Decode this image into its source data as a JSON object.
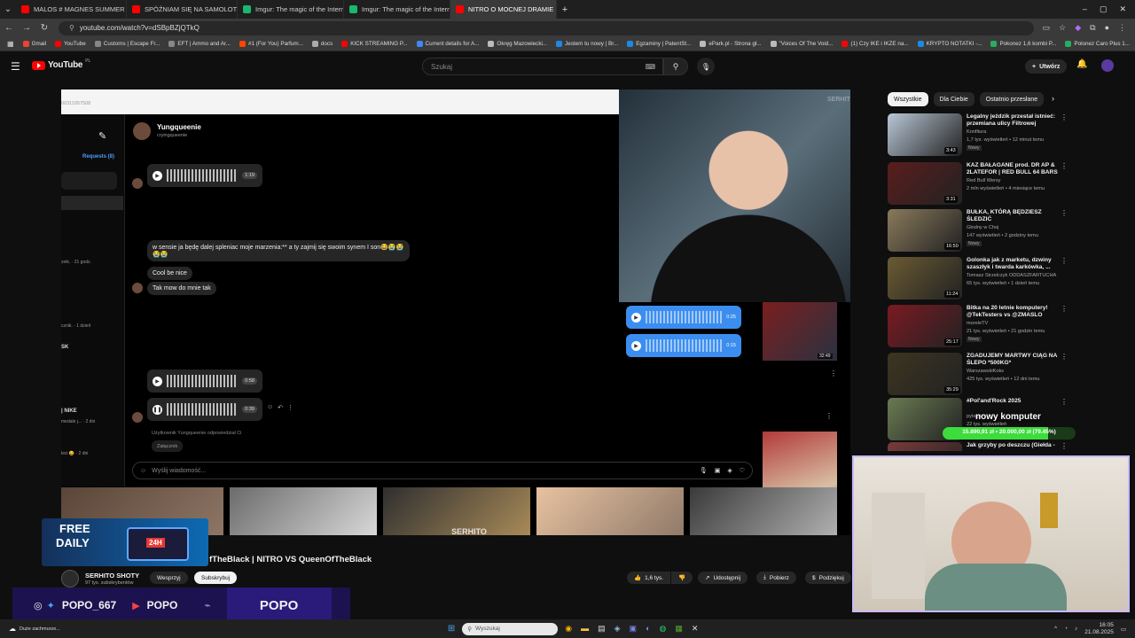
{
  "browser": {
    "tabs": [
      {
        "label": "MALOS # MAGNES SUMMER",
        "color": "#ff0000"
      },
      {
        "label": "SPÓŹNIAM SIĘ NA SAMOLOT",
        "color": "#ff0000"
      },
      {
        "label": "Imgur: The magic of the Intern",
        "color": "#1bb76e"
      },
      {
        "label": "Imgur: The magic of the Intern",
        "color": "#1bb76e"
      },
      {
        "label": "NITRO O MOCNEJ DRAMIE",
        "color": "#ff0000"
      }
    ],
    "url": "youtube.com/watch?v=dSBpBZjQTkQ",
    "bookmarks": [
      {
        "label": "Gmail",
        "color": "#ea4335"
      },
      {
        "label": "YouTube",
        "color": "#ff0000"
      },
      {
        "label": "Customs | Escape Fr...",
        "color": "#888888"
      },
      {
        "label": "EFT | Ammo and Ar...",
        "color": "#888888"
      },
      {
        "label": "#1 (For You) Parfum...",
        "color": "#ff4500"
      },
      {
        "label": "docs",
        "color": "#aaaaaa"
      },
      {
        "label": "KICK STREAMING P...",
        "color": "#ff0000"
      },
      {
        "label": "Current details for A...",
        "color": "#4285f4"
      },
      {
        "label": "Okręg Mazowiecki...",
        "color": "#bbbbbb"
      },
      {
        "label": "Jestem tu nowy | Br...",
        "color": "#1e88e5"
      },
      {
        "label": "Egzaminy | PatentSt...",
        "color": "#1e88e5"
      },
      {
        "label": "ePark.pl - Strona gł...",
        "color": "#bbbbbb"
      },
      {
        "label": "\"Voices Of The Void...",
        "color": "#bbbbbb"
      },
      {
        "label": "(1) Czy IKE i IKZE na...",
        "color": "#ff0000"
      },
      {
        "label": "KRYPTO NOTATKI -...",
        "color": "#1e88e5"
      },
      {
        "label": "Pokonez 1,6 kombi P...",
        "color": "#27ae60"
      },
      {
        "label": "Polonez Caro Plus 1...",
        "color": "#27ae60"
      }
    ]
  },
  "youtube": {
    "logo": "YouTube",
    "region": "PL",
    "search_placeholder": "Szukaj",
    "create_label": "Utwórz",
    "filters": [
      "Wszystkie",
      "Dla Ciebie",
      "Ostatnio przesłane"
    ],
    "video_title": "fTheBlack | NITRO VS QueenOfTheBlack",
    "channel_name": "SERHITO SHOTY",
    "channel_subs": "97 tys. subskrybentów",
    "support_label": "Wesprzyj",
    "subscribe_label": "Subskrybuj",
    "likes": "1,6 tys.",
    "share_label": "Udostępnij",
    "download_label": "Pobierz",
    "thanks_label": "Podziękuj",
    "watermark": "SERHITO SHOTY"
  },
  "dm": {
    "account_id": "00311957508",
    "username": "Yungqueenie",
    "handle": "cryingqueenie",
    "requests_label": "Requests (8)",
    "sidebar_texts": [
      "znik. · 21 godz.",
      "cznik. · 1 dzień",
      "SK",
      "| NIKE",
      "medale j... · 2 dni",
      "leci 😀 · 2 dni"
    ],
    "messages": [
      {
        "text": "w sensie ja będę dalej spleniac moje marzenia:** a ty zajmij się swoim synem I son😂😭😭😭😭"
      },
      {
        "text": "Cool be nice"
      },
      {
        "text": "Tak mow do mnie tak"
      }
    ],
    "voice_times": [
      "1:19",
      "0:58",
      "0:39"
    ],
    "sent_voice_times": [
      "0:25",
      "0:15"
    ],
    "reply_note": "Użytkownik Yungqueenie odpowiedział Ci",
    "reply_preview": "Załącznik",
    "input_placeholder": "Wyślij wiadomość...",
    "thumb_duration": "32:49"
  },
  "recommendations": [
    {
      "title": "Legalny jeździk przestał istnieć: przemiana ulicy Filtrowej",
      "channel": "Konfitura",
      "meta": "1,7 tys. wyświetleń • 12 minut temu",
      "badge": "Nowy",
      "duration": "3:43",
      "color": "#b9c7d6"
    },
    {
      "title": "KAZ BAŁAGANE prod. DR AP & 2LATEFOR | RED BULL 64 BARS",
      "channel": "Red Bull Wersy",
      "meta": "2 mln wyświetleń • 4 miesiące temu",
      "badge": "",
      "duration": "3:31",
      "color": "#5a1d1d"
    },
    {
      "title": "BUŁKA, KTÓRĄ BĘDZIESZ ŚLEDZIĆ",
      "channel": "Głodny w Choj",
      "meta": "147 wyświetleń • 2 godziny temu",
      "badge": "Nowy",
      "duration": "16:50",
      "color": "#8a7a5c"
    },
    {
      "title": "Golonka jak z marketu, dzwiny szaszłyk i twarda karkówka, ...",
      "channel": "Tomasz Strzelczyk ODDASZFARTUCHA",
      "meta": "65 tys. wyświetleń • 1 dzień temu",
      "badge": "",
      "duration": "11:24",
      "color": "#6b5b33"
    },
    {
      "title": "Bitka na 20 letnie komputery! @TekTesters vs @ZMASLO",
      "channel": "moreleTV",
      "meta": "21 tys. wyświetleń • 21 godzin temu",
      "badge": "Nowy",
      "duration": "25:17",
      "color": "#7a1a22"
    },
    {
      "title": "ZGADUJEMY MARTWY CIĄG NA ŚLEPO *500KG*",
      "channel": "WarszawskiKoks",
      "meta": "425 tys. wyświetleń • 12 dni temu",
      "badge": "",
      "duration": "35:29",
      "color": "#3d3521"
    },
    {
      "title": "#Pol'and'Rock 2025",
      "channel": "pyta.pl",
      "meta": "22 tys. wyświetleń",
      "badge": "",
      "duration": "",
      "color": "#6a7b53"
    },
    {
      "title": "Jak grzyby po deszczu (Giełda - ...",
      "channel": "",
      "meta": "",
      "badge": "",
      "duration": "",
      "color": "#7a3a3a"
    }
  ],
  "overlay": {
    "goal_title": "nowy komputer",
    "goal_progress": "15.890,91 zł • 20.000,00 zł (79.45%)",
    "goal_fraction": 0.7945,
    "free_daily_line1": "FREE",
    "free_daily_line2": "DAILY",
    "free_daily_badge": "24H",
    "social_handle": "POPO_667",
    "yt_handle": "POPO",
    "brand": "POPO",
    "cam_status": "Duże zachmurze..."
  },
  "taskbar": {
    "search_placeholder": "Wyszukaj",
    "time": "16:05",
    "date": "21.08.2025"
  }
}
